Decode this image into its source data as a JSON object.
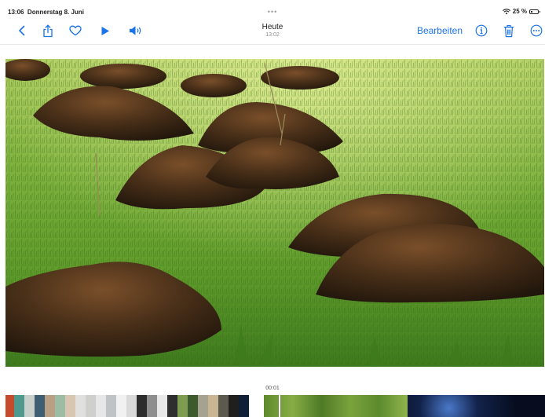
{
  "status_bar": {
    "time": "13:06",
    "date": "Donnerstag 8. Juni",
    "dots": "•••",
    "battery": "25 %",
    "battery_level": 0.25
  },
  "toolbar": {
    "icons": [
      "back-chevron-icon",
      "share-icon",
      "heart-icon",
      "play-icon",
      "speaker-icon",
      "info-icon",
      "trash-icon",
      "more-icon"
    ],
    "title": "Heute",
    "subtitle": "13:02",
    "edit_label": "Bearbeiten"
  },
  "scrubber": {
    "timecode": "00:01"
  },
  "colors": {
    "accent": "#1a73e8",
    "grass": "#5f9a2a",
    "soil": "#3a2716"
  }
}
